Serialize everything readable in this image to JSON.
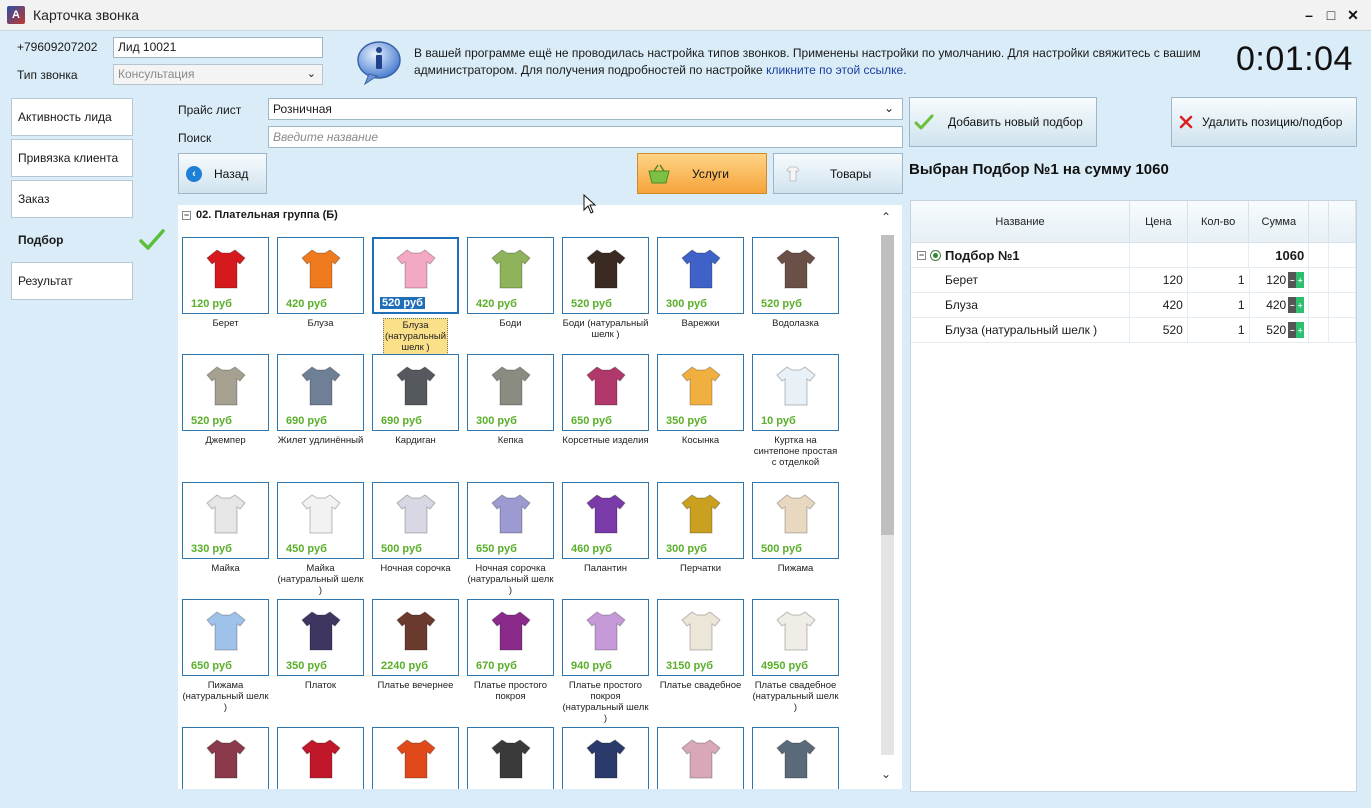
{
  "window": {
    "title": "Карточка звонка"
  },
  "header": {
    "phone": "+79609207202",
    "lead_name": "Лид 10021",
    "call_type_label": "Тип звонка",
    "call_type_value": "Консультация",
    "info_text": "В вашей программе ещё не проводилась настройка типов звонков. Применены настройки по умолчанию. Для настройки свяжитесь с вашим администратором. Для получения подробностей по настройке ",
    "info_link": "кликните по этой ссылке.",
    "timer": "0:01:04"
  },
  "nav": {
    "items": [
      {
        "label": "Активность лида",
        "active": false
      },
      {
        "label": "Привязка клиента",
        "active": false
      },
      {
        "label": "Заказ",
        "active": false
      },
      {
        "label": "Подбор",
        "active": true
      },
      {
        "label": "Результат",
        "active": false
      }
    ]
  },
  "filters": {
    "price_label": "Прайс лист",
    "price_value": "Розничная",
    "search_label": "Поиск",
    "search_placeholder": "Введите название"
  },
  "buttons": {
    "back": "Назад",
    "services": "Услуги",
    "goods": "Товары",
    "add_selection": "Добавить новый подбор",
    "delete_selection": "Удалить позицию/подбор"
  },
  "catalog": {
    "group": "02. Плательная группа (Б)",
    "items": [
      {
        "name": "Берет",
        "price": "120 руб",
        "color": "#d6191c"
      },
      {
        "name": "Блуза",
        "price": "420 руб",
        "color": "#f07a1e"
      },
      {
        "name": "Блуза (натуральный шелк )",
        "price": "520 руб",
        "color": "#f3a8c4",
        "selected": true
      },
      {
        "name": "Боди",
        "price": "420 руб",
        "color": "#8fb35a"
      },
      {
        "name": "Боди (натуральный шелк )",
        "price": "520 руб",
        "color": "#3a2a22"
      },
      {
        "name": "Варежки",
        "price": "300 руб",
        "color": "#3f62c9"
      },
      {
        "name": "Водолазка",
        "price": "520 руб",
        "color": "#6b5048"
      },
      {
        "name": "Джемпер",
        "price": "520 руб",
        "color": "#a6a090"
      },
      {
        "name": "Жилет удлинённый",
        "price": "690 руб",
        "color": "#6f7f95"
      },
      {
        "name": "Кардиган",
        "price": "690 руб",
        "color": "#55585c"
      },
      {
        "name": "Кепка",
        "price": "300 руб",
        "color": "#8a8c82"
      },
      {
        "name": "Корсетные изделия",
        "price": "650 руб",
        "color": "#b1386a"
      },
      {
        "name": "Косынка",
        "price": "350 руб",
        "color": "#f0b040"
      },
      {
        "name": "Куртка на синтепоне простая с отделкой",
        "price": "10 руб",
        "color": "#e8f0f8"
      },
      {
        "name": "Майка",
        "price": "330 руб",
        "color": "#e6e6e6"
      },
      {
        "name": "Майка (натуральный шелк )",
        "price": "450 руб",
        "color": "#f2f2f2"
      },
      {
        "name": "Ночная сорочка",
        "price": "500 руб",
        "color": "#d8d8e4"
      },
      {
        "name": "Ночная сорочка (натуральный шелк )",
        "price": "650 руб",
        "color": "#9c9ad0"
      },
      {
        "name": "Палантин",
        "price": "460 руб",
        "color": "#7a3aa8"
      },
      {
        "name": "Перчатки",
        "price": "300 руб",
        "color": "#c9a020"
      },
      {
        "name": "Пижама",
        "price": "500 руб",
        "color": "#e8d8c0"
      },
      {
        "name": "Пижама (натуральный шелк )",
        "price": "650 руб",
        "color": "#9fc2ea"
      },
      {
        "name": "Платок",
        "price": "350 руб",
        "color": "#3e3560"
      },
      {
        "name": "Платье вечернее",
        "price": "2240 руб",
        "color": "#6b3a2e"
      },
      {
        "name": "Платье простого покроя",
        "price": "670 руб",
        "color": "#8a2a8a"
      },
      {
        "name": "Платье простого покроя (натуральный шелк )",
        "price": "940 руб",
        "color": "#c69ad8"
      },
      {
        "name": "Платье свадебное",
        "price": "3150 руб",
        "color": "#ece6d8"
      },
      {
        "name": "Платье свадебное (натуральный шелк )",
        "price": "4950 руб",
        "color": "#f0ede6"
      },
      {
        "name": "",
        "price": "",
        "color": "#8a3a4a"
      },
      {
        "name": "",
        "price": "",
        "color": "#c0182a"
      },
      {
        "name": "",
        "price": "",
        "color": "#e04a1a"
      },
      {
        "name": "",
        "price": "",
        "color": "#3a3a3a"
      },
      {
        "name": "",
        "price": "",
        "color": "#2a3a6a"
      },
      {
        "name": "",
        "price": "",
        "color": "#d8a8b8"
      },
      {
        "name": "",
        "price": "",
        "color": "#5a6a7a"
      }
    ]
  },
  "selection": {
    "title": "Выбран Подбор №1 на сумму 1060",
    "columns": [
      "Название",
      "Цена",
      "Кол-во",
      "Сумма"
    ],
    "group_name": "Подбор №1",
    "group_total": "1060",
    "rows": [
      {
        "name": "Берет",
        "price": "120",
        "qty": "1",
        "sum": "120"
      },
      {
        "name": "Блуза",
        "price": "420",
        "qty": "1",
        "sum": "420"
      },
      {
        "name": "Блуза (натуральный шелк )",
        "price": "520",
        "qty": "1",
        "sum": "520"
      }
    ]
  }
}
